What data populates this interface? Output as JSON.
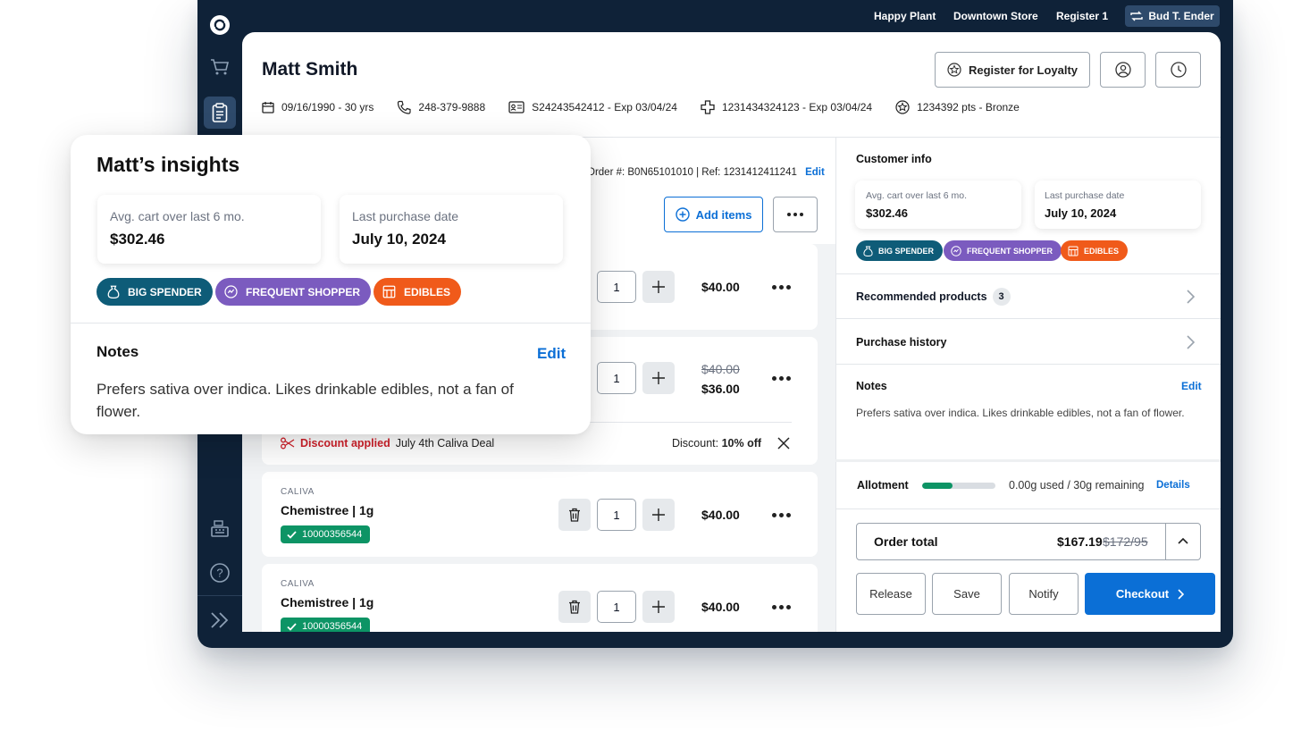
{
  "topbar": {
    "store_name": "Happy Plant",
    "location": "Downtown Store",
    "register": "Register 1",
    "user": "Bud T. Ender"
  },
  "customer": {
    "name": "Matt Smith",
    "dob": "09/16/1990 - 30 yrs",
    "phone": "248-379-9888",
    "id": "S24243542412 - Exp 03/04/24",
    "medical": "1231434324123 - Exp 03/04/24",
    "loyalty": "1234392 pts - Bronze"
  },
  "header_buttons": {
    "register_loyalty": "Register for Loyalty"
  },
  "order": {
    "ref_text": "Order #: B0N65101010  |  Ref: 1231412411241",
    "edit": "Edit",
    "add_items": "Add items"
  },
  "items": [
    {
      "qty": "1",
      "price": "$40.00"
    },
    {
      "qty": "1",
      "original_price": "$40.00",
      "price": "$36.00",
      "discount_label": "Discount applied",
      "discount_name": "July 4th Caliva Deal",
      "discount_prefix": "Discount:",
      "discount_value": "10% off"
    },
    {
      "brand": "CALIVA",
      "name": "Chemistree | 1g",
      "sku": "10000356544",
      "qty": "1",
      "price": "$40.00"
    },
    {
      "brand": "CALIVA",
      "name": "Chemistree | 1g",
      "sku": "10000356544",
      "qty": "1",
      "price": "$40.00"
    }
  ],
  "sidebar": {
    "customer_info_title": "Customer info",
    "avg_cart_label": "Avg. cart over last 6 mo.",
    "avg_cart_value": "$302.46",
    "last_purchase_label": "Last purchase date",
    "last_purchase_value": "July 10, 2024",
    "tags": [
      "BIG SPENDER",
      "FREQUENT SHOPPER",
      "EDIBLES"
    ],
    "recommended_label": "Recommended products",
    "recommended_count": "3",
    "purchase_history_label": "Purchase history",
    "notes_title": "Notes",
    "notes_edit": "Edit",
    "notes_text": "Prefers sativa over indica. Likes drinkable edibles, not a fan of flower.",
    "allotment_label": "Allotment",
    "allotment_used_fraction": 0.42,
    "allotment_text": "0.00g used / 30g remaining",
    "allotment_details": "Details",
    "order_total_label": "Order total",
    "order_total_value": "$167.19",
    "order_total_original": "$172/95",
    "buttons": {
      "release": "Release",
      "save": "Save",
      "notify": "Notify",
      "checkout": "Checkout"
    }
  },
  "insights": {
    "title": "Matt’s insights",
    "avg_cart_label": "Avg. cart over last 6 mo.",
    "avg_cart_value": "$302.46",
    "last_purchase_label": "Last purchase date",
    "last_purchase_value": "July 10, 2024",
    "tags": [
      "BIG SPENDER",
      "FREQUENT SHOPPER",
      "EDIBLES"
    ],
    "notes_title": "Notes",
    "notes_edit": "Edit",
    "notes_text": "Prefers sativa over indica. Likes drinkable edibles, not a fan of flower."
  },
  "colors": {
    "navy": "#0f2238",
    "accent_blue": "#0b6fd6",
    "green": "#0d9465",
    "tag_big_spender": "#0e5c78",
    "tag_frequent_shopper": "#7b5bbf",
    "tag_edibles": "#f05a1a",
    "discount_red": "#d0202a"
  }
}
